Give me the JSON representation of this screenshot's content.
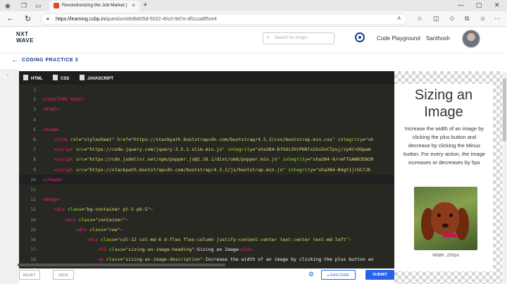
{
  "browser": {
    "tab_title": "Revolutionizing the Job Market |",
    "url_host": "https://learning.ccbp.in",
    "url_path": "/question/eb9b825d-5022-45c0-9d7e-df1cca8f5ce4"
  },
  "header": {
    "logo_line1": "NXT",
    "logo_line2": "WAVE",
    "search_placeholder": "Search for Anayo",
    "code_playground": "Code Playground",
    "user_name": "Santhosh"
  },
  "problem": {
    "title": "CODING PRACTICE 3"
  },
  "editor": {
    "tabs": [
      "HTML",
      "CSS",
      "JAVASCRIPT"
    ],
    "line_numbers": [
      "1",
      "2",
      "3",
      "4",
      "5",
      "6",
      "7",
      "8",
      "9",
      "10",
      "11",
      "12",
      "13",
      "14",
      "15",
      "16",
      "17",
      "18",
      "19"
    ]
  },
  "footer": {
    "reset": "RESET",
    "save": "SAVE",
    "run": "▸ RUN CODE",
    "submit": "SUBMIT"
  },
  "preview": {
    "heading": "Sizing an Image",
    "description": "Increase the width of an image by clicking the plus button and decrease by clicking the Minus button. For every action, the image increases or decreases by 5px",
    "width_label": "Width: 200px"
  }
}
